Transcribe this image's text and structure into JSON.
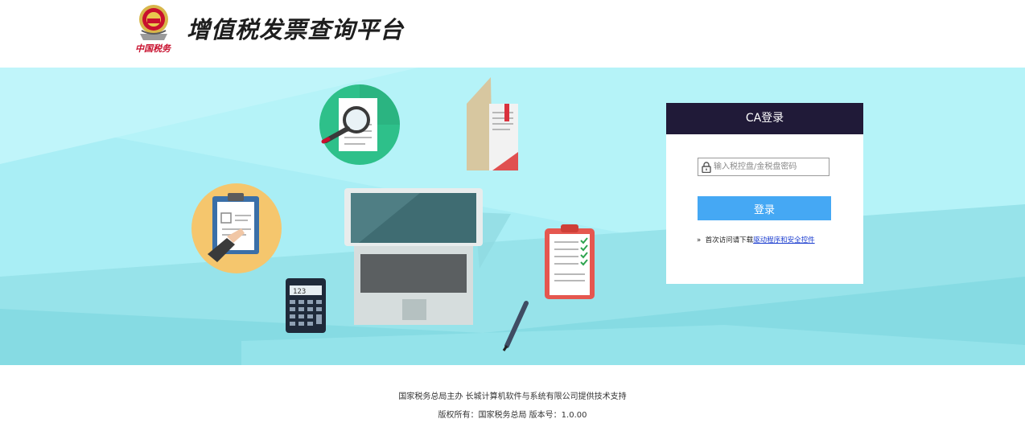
{
  "header": {
    "title": "增值税发票查询平台",
    "emblem_caption": "中国税务"
  },
  "login": {
    "heading": "CA登录",
    "password_placeholder": "输入税控盘/金税盘密码",
    "password_value": "",
    "submit_label": "登录",
    "tip_prefix": "首次访问请下载",
    "tip_link": "驱动程序和安全控件",
    "bullet": "»"
  },
  "illustration": {
    "calculator_display": "123"
  },
  "footer": {
    "line1": "国家税务总局主办  长城计算机软件与系统有限公司提供技术支持",
    "line2": "版权所有：国家税务总局  版本号：1.0.00"
  },
  "colors": {
    "banner_bg": "#a9eef5",
    "login_header": "#201a38",
    "login_button": "#45a8f4",
    "link": "#1a3ccf"
  },
  "icons": [
    "national-emblem-icon",
    "lock-icon",
    "magnifier-document-icon",
    "book-icon",
    "clipboard-icon",
    "laptop-icon",
    "calculator-icon",
    "checklist-icon",
    "pen-icon"
  ]
}
